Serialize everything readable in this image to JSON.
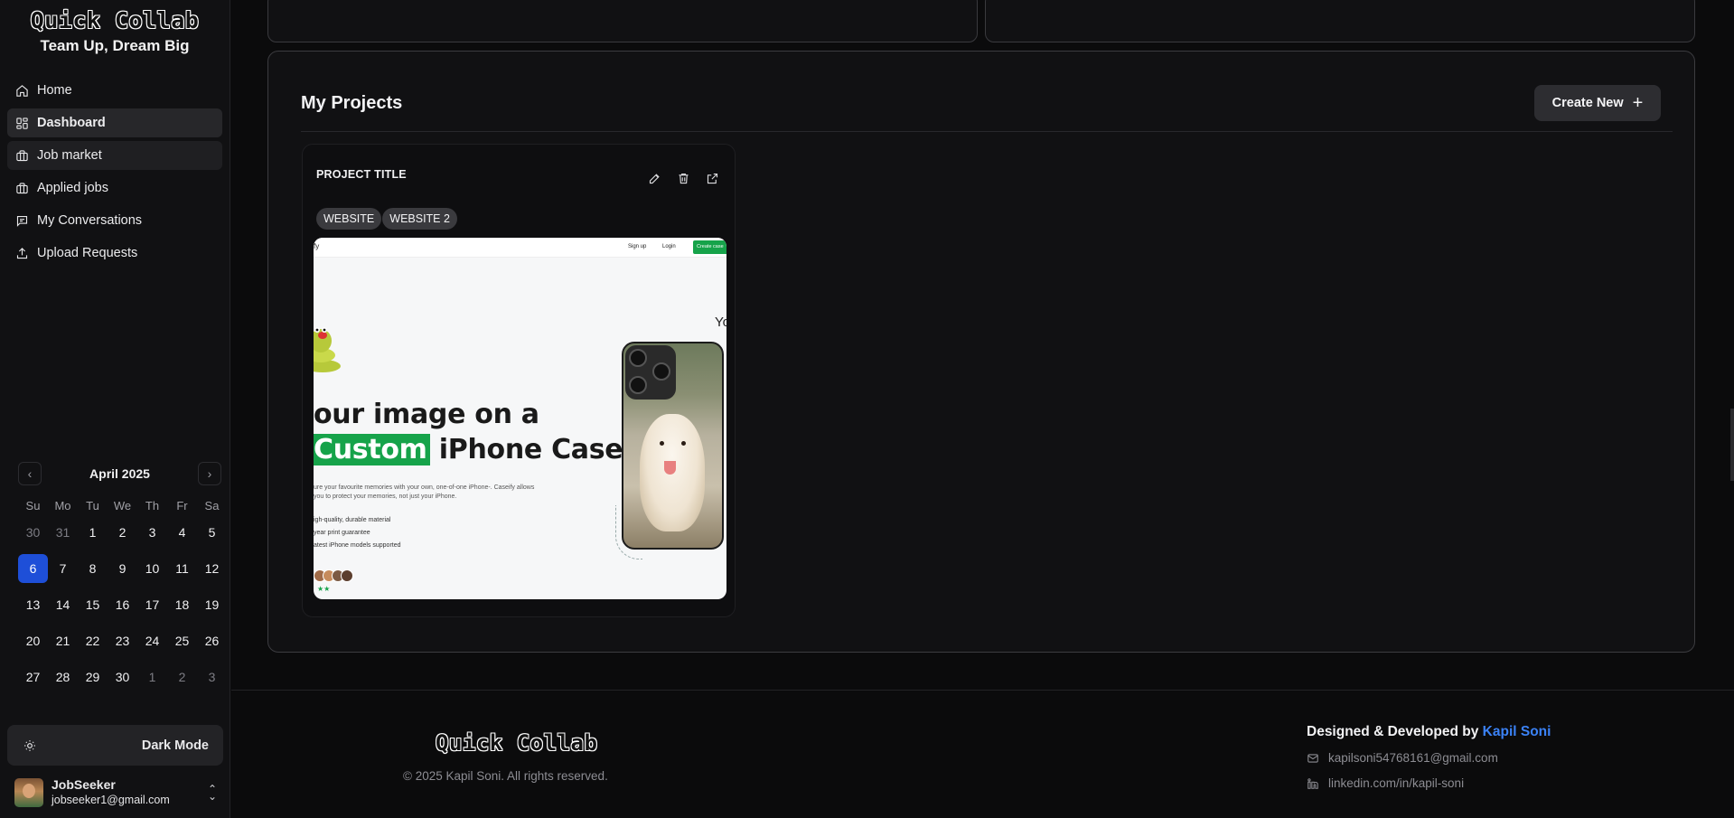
{
  "brand": {
    "logo": "Quick Collab",
    "tagline": "Team Up, Dream Big"
  },
  "nav": [
    {
      "label": "Home",
      "icon": "home-icon"
    },
    {
      "label": "Dashboard",
      "icon": "dashboard-icon",
      "active": true
    },
    {
      "label": "Job market",
      "icon": "briefcase-icon"
    },
    {
      "label": "Applied jobs",
      "icon": "briefcase-icon"
    },
    {
      "label": "My Conversations",
      "icon": "message-icon"
    },
    {
      "label": "Upload Requests",
      "icon": "upload-icon"
    }
  ],
  "calendar": {
    "title": "April 2025",
    "weekdays": [
      "Su",
      "Mo",
      "Tu",
      "We",
      "Th",
      "Fr",
      "Sa"
    ],
    "weeks": [
      [
        "30",
        "31",
        "1",
        "2",
        "3",
        "4",
        "5"
      ],
      [
        "6",
        "7",
        "8",
        "9",
        "10",
        "11",
        "12"
      ],
      [
        "13",
        "14",
        "15",
        "16",
        "17",
        "18",
        "19"
      ],
      [
        "20",
        "21",
        "22",
        "23",
        "24",
        "25",
        "26"
      ],
      [
        "27",
        "28",
        "29",
        "30",
        "1",
        "2",
        "3"
      ]
    ],
    "selected": "6",
    "accent": "#1e4fd8"
  },
  "theme": {
    "label": "Dark Mode"
  },
  "user": {
    "name": "JobSeeker",
    "email": "jobseeker1@gmail.com"
  },
  "projects": {
    "heading": "My Projects",
    "create_label": "Create New",
    "items": [
      {
        "title": "PROJECT TITLE",
        "tags": [
          "WEBSITE",
          "WEBSITE 2"
        ],
        "preview": {
          "brand_fragment": "fy",
          "nav_signup": "Sign up",
          "nav_login": "Login",
          "nav_cta": "Create case",
          "headline_1": "our image on a",
          "headline_highlight": "Custom",
          "headline_2": " iPhone Case",
          "paragraph": "ure your favourite memories with your own, one-of-one iPhone-. Caseify allows you to protect your memories, not just your iPhone.",
          "bullets": [
            "igh-quality, durable material",
            " year print guarantee",
            "atest iPhone models supported"
          ],
          "side_text": "Yo",
          "accent": "#16a34a"
        }
      }
    ]
  },
  "footer": {
    "logo": "Quick Collab",
    "copyright": "© 2025 Kapil Soni. All rights reserved.",
    "credit_prefix": "Designed & Developed by ",
    "credit_name": "Kapil Soni",
    "email": "kapilsoni54768161@gmail.com",
    "linkedin": "linkedin.com/in/kapil-soni"
  }
}
